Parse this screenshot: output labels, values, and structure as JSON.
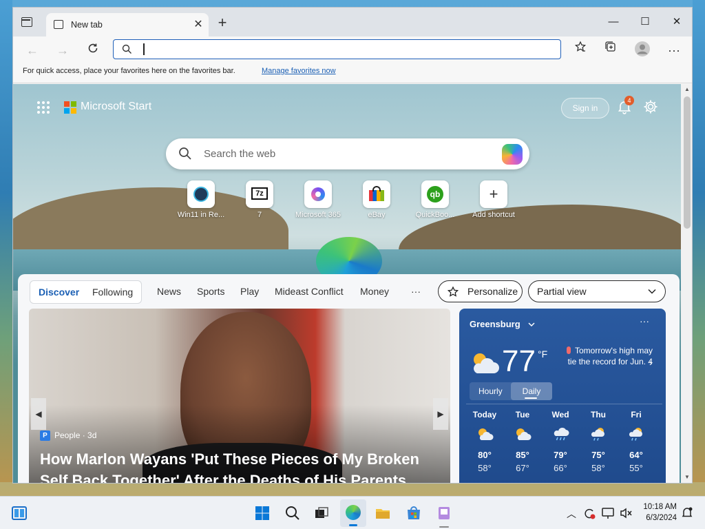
{
  "browser": {
    "tab_title": "New tab",
    "address_placeholder": "",
    "favorites_bar_text": "For quick access, place your favorites here on the favorites bar.",
    "manage_favorites_label": "Manage favorites now"
  },
  "ntp": {
    "brand": "Microsoft Start",
    "sign_in_label": "Sign in",
    "notification_count": "4",
    "search_placeholder": "Search the web",
    "shortcuts": [
      {
        "label": "Win11 in Re...",
        "icon": "win11-icon"
      },
      {
        "label": "7",
        "icon": "7zip-icon"
      },
      {
        "label": "Microsoft 365",
        "icon": "microsoft365-icon"
      },
      {
        "label": "eBay",
        "icon": "ebay-icon"
      },
      {
        "label": "QuickBoo...",
        "icon": "quickbooks-icon"
      },
      {
        "label": "Add shortcut",
        "icon": "plus-icon"
      }
    ]
  },
  "feed": {
    "tabs": [
      "Discover",
      "Following"
    ],
    "nav": [
      "News",
      "Sports",
      "Play",
      "Mideast Conflict",
      "Money",
      "···"
    ],
    "personalize_label": "Personalize",
    "view_label": "Partial view",
    "hero": {
      "source": "People · 3d",
      "headline": "How Marlon Wayans 'Put These Pieces of My Broken Self Back Together' After the Deaths of His Parents"
    }
  },
  "weather": {
    "location": "Greensburg",
    "temperature": "77",
    "unit": "°F",
    "alert": "Tomorrow's high may tie the record for Jun. 4",
    "hourly_label": "Hourly",
    "daily_label": "Daily",
    "days": [
      {
        "name": "Today",
        "high": "80°",
        "low": "58°",
        "icon": "partly-sunny-icon"
      },
      {
        "name": "Tue",
        "high": "85°",
        "low": "67°",
        "icon": "partly-sunny-icon"
      },
      {
        "name": "Wed",
        "high": "79°",
        "low": "66°",
        "icon": "rain-icon"
      },
      {
        "name": "Thu",
        "high": "75°",
        "low": "58°",
        "icon": "rain-sun-icon"
      },
      {
        "name": "Fri",
        "high": "64°",
        "low": "55°",
        "icon": "rain-sun-icon"
      }
    ]
  },
  "taskbar": {
    "time": "10:18 AM",
    "date": "6/3/2024"
  },
  "colors": {
    "accent": "#1a5fb4",
    "weather_bg": "#2a5aa0",
    "badge": "#e25d2b"
  }
}
